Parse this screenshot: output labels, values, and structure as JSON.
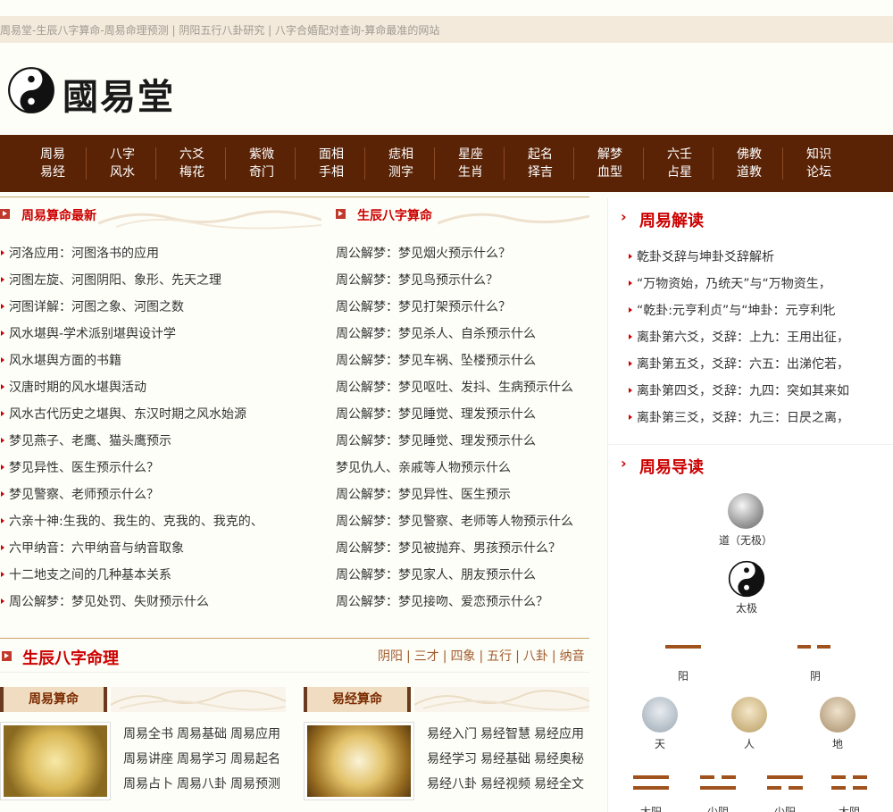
{
  "topbar": {
    "text": "周易堂-生辰八字算命-周易命理预测 | 阴阳五行八卦研究 | 八字合婚配对查询-算命最准的网站"
  },
  "logo": {
    "name": "國易堂"
  },
  "nav": [
    [
      "周易",
      "易经"
    ],
    [
      "八字",
      "风水"
    ],
    [
      "六爻",
      "梅花"
    ],
    [
      "紫微",
      "奇门"
    ],
    [
      "面相",
      "手相"
    ],
    [
      "痣相",
      "测字"
    ],
    [
      "星座",
      "生肖"
    ],
    [
      "起名",
      "择吉"
    ],
    [
      "解梦",
      "血型"
    ],
    [
      "六壬",
      "占星"
    ],
    [
      "佛教",
      "道教"
    ],
    [
      "知识",
      "论坛"
    ]
  ],
  "left_section": {
    "title": "周易算命最新",
    "items": [
      "河洛应用：河图洛书的应用",
      "河图左旋、河图阴阳、象形、先天之理",
      "河图详解：河图之象、河图之数",
      "风水堪舆-学术派别堪舆设计学",
      "风水堪舆方面的书籍",
      "汉唐时期的风水堪舆活动",
      "风水古代历史之堪舆、东汉时期之风水始源",
      "梦见燕子、老鹰、猫头鹰预示",
      "梦见异性、医生预示什么？",
      "梦见警察、老师预示什么？",
      "六亲十神:生我的、我生的、克我的、我克的、",
      "六甲纳音：六甲纳音与纳音取象",
      "十二地支之间的几种基本关系",
      "周公解梦：梦见处罚、失财预示什么"
    ]
  },
  "mid_section": {
    "title": "生辰八字算命",
    "items": [
      "周公解梦：梦见烟火预示什么？",
      "周公解梦：梦见鸟预示什么？",
      "周公解梦：梦见打架预示什么？",
      "周公解梦：梦见杀人、自杀预示什么",
      "周公解梦：梦见车祸、坠楼预示什么",
      "周公解梦：梦见呕吐、发抖、生病预示什么",
      "周公解梦：梦见睡觉、理发预示什么",
      "周公解梦：梦见睡觉、理发预示什么",
      "梦见仇人、亲戚等人物预示什么",
      "周公解梦：梦见异性、医生预示",
      "周公解梦：梦见警察、老师等人物预示什么",
      "周公解梦：梦见被抛弃、男孩预示什么？",
      "周公解梦：梦见家人、朋友预示什么",
      "周公解梦：梦见接吻、爱恋预示什么？"
    ]
  },
  "right_section": {
    "title": "周易解读",
    "items": [
      "乾卦爻辞与坤卦爻辞解析",
      "“万物资始，乃统天”与“万物资生，",
      "“乾卦:元亨利贞”与“坤卦：元亨利牝",
      "离卦第六爻，爻辞：上九：王用出征，",
      "离卦第五爻，爻辞：六五：出涕佗若，",
      "离卦第四爻，爻辞：九四：突如其来如",
      "离卦第三爻，爻辞：九三：日昃之离，"
    ]
  },
  "guide": {
    "title": "周易导读",
    "dao": "道（无极）",
    "taiji": "太极",
    "yang": "阳",
    "yin": "阴",
    "tian": "天",
    "ren": "人",
    "di": "地",
    "bottom_labels": [
      "太阳",
      "少阴",
      "少阳",
      "太阴"
    ]
  },
  "bazi": {
    "title": "生辰八字命理",
    "links": [
      "阴阳",
      "三才",
      "四象",
      "五行",
      "八卦",
      "纳音"
    ],
    "sep": "|"
  },
  "box1": {
    "tab": "周易算命",
    "rows": [
      [
        "周易全书",
        "周易基础",
        "周易应用"
      ],
      [
        "周易讲座",
        "周易学习",
        "周易起名"
      ],
      [
        "周易占卜",
        "周易八卦",
        "周易预测"
      ]
    ]
  },
  "box2": {
    "tab": "易经算命",
    "rows": [
      [
        "易经入门",
        "易经智慧",
        "易经应用"
      ],
      [
        "易经学习",
        "易经基础",
        "易经奥秘"
      ],
      [
        "易经八卦",
        "易经视频",
        "易经全文"
      ]
    ]
  },
  "colors": {
    "nav_bg": "#5a2306",
    "accent": "#cc0000",
    "gold": "#c9a46a"
  }
}
